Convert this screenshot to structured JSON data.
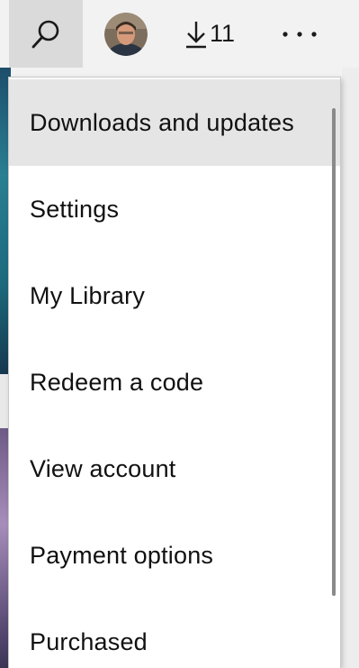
{
  "toolbar": {
    "search_icon": "search-icon",
    "avatar_icon": "user-avatar",
    "downloads_icon": "download-arrow-icon",
    "downloads_count": "11",
    "more_icon": "more-ellipsis-icon"
  },
  "menu": {
    "items": [
      {
        "label": "Downloads and updates",
        "active": true
      },
      {
        "label": "Settings",
        "active": false
      },
      {
        "label": "My Library",
        "active": false
      },
      {
        "label": "Redeem a code",
        "active": false
      },
      {
        "label": "View account",
        "active": false
      },
      {
        "label": "Payment options",
        "active": false
      },
      {
        "label": "Purchased",
        "active": false
      }
    ]
  },
  "colors": {
    "toolbar_bg": "#f2f2f2",
    "search_active_bg": "#dadada",
    "menu_bg": "#ffffff",
    "menu_hover_bg": "#e5e5e5",
    "text": "#111111",
    "scrollbar": "#8a8a8a"
  }
}
